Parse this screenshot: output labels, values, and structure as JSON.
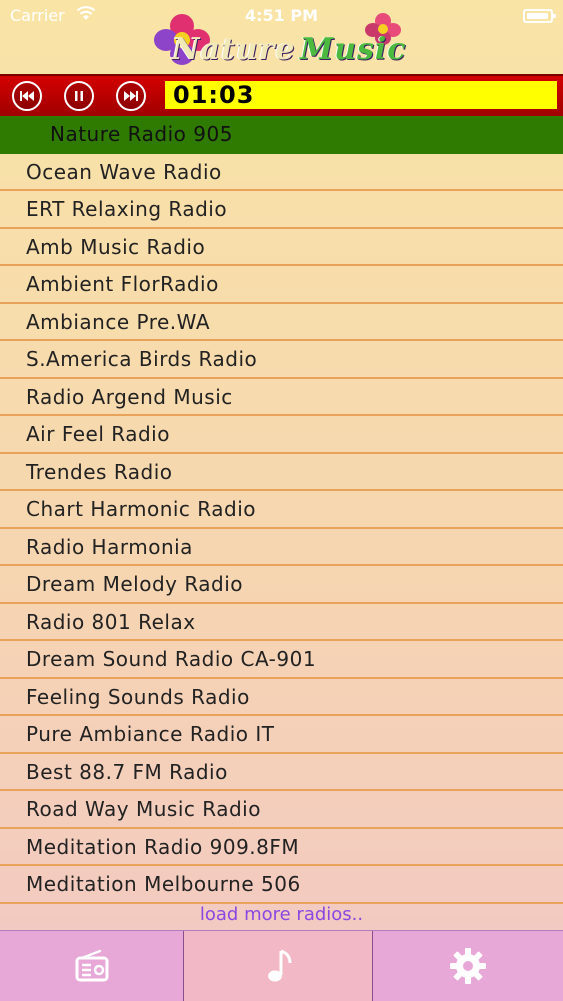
{
  "status_bar": {
    "carrier": "Carrier",
    "time": "4:51 PM"
  },
  "logo": {
    "word1": "Nature",
    "word2": "Music"
  },
  "player": {
    "time": "01:03"
  },
  "stations": [
    "Nature Radio 905",
    "Ocean Wave Radio",
    "ERT Relaxing Radio",
    "Amb Music Radio",
    "Ambient FlorRadio",
    "Ambiance Pre.WA",
    "S.America Birds Radio",
    "Radio Argend Music",
    "Air Feel Radio",
    "Trendes Radio",
    "Chart Harmonic Radio",
    "Radio Harmonia",
    "Dream Melody Radio",
    "Radio 801 Relax",
    "Dream Sound Radio CA-901",
    "Feeling Sounds Radio",
    "Pure Ambiance Radio IT",
    "Best 88.7 FM Radio",
    "Road Way Music Radio",
    "Meditation Radio 909.8FM",
    "Meditation Melbourne 506"
  ],
  "load_more": "load more radios..",
  "colors": {
    "player_bg": "#c40000",
    "time_bg": "#ffff00",
    "active_row": "#2f7a00",
    "tab_bg": "#e7a8d8",
    "link": "#8a48e0"
  },
  "icons": {
    "prev": "rewind-icon",
    "pause": "pause-icon",
    "next": "fast-forward-icon",
    "tab1": "radio-icon",
    "tab2": "music-note-icon",
    "tab3": "gear-icon"
  }
}
